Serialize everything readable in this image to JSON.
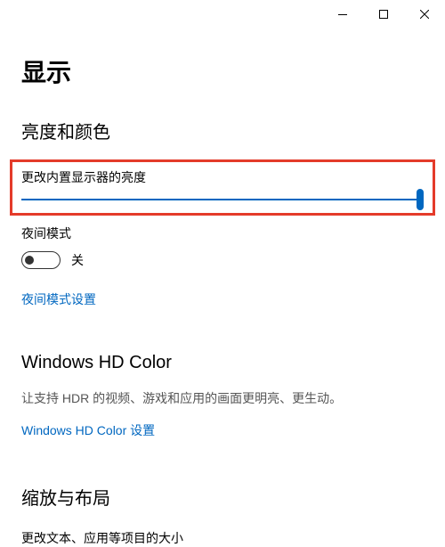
{
  "titlebar": {
    "minimize": "–",
    "maximize": "□",
    "close": "×"
  },
  "page": {
    "title": "显示"
  },
  "brightness": {
    "heading": "亮度和颜色",
    "slider_label": "更改内置显示器的亮度",
    "slider_value": 100,
    "night_mode_label": "夜间模式",
    "night_mode_status": "关",
    "night_mode_link": "夜间模式设置"
  },
  "hdcolor": {
    "heading": "Windows HD Color",
    "description": "让支持 HDR 的视频、游戏和应用的画面更明亮、更生动。",
    "link": "Windows HD Color 设置"
  },
  "scale": {
    "heading": "缩放与布局",
    "partial": "更改文本、应用等项目的大小"
  }
}
